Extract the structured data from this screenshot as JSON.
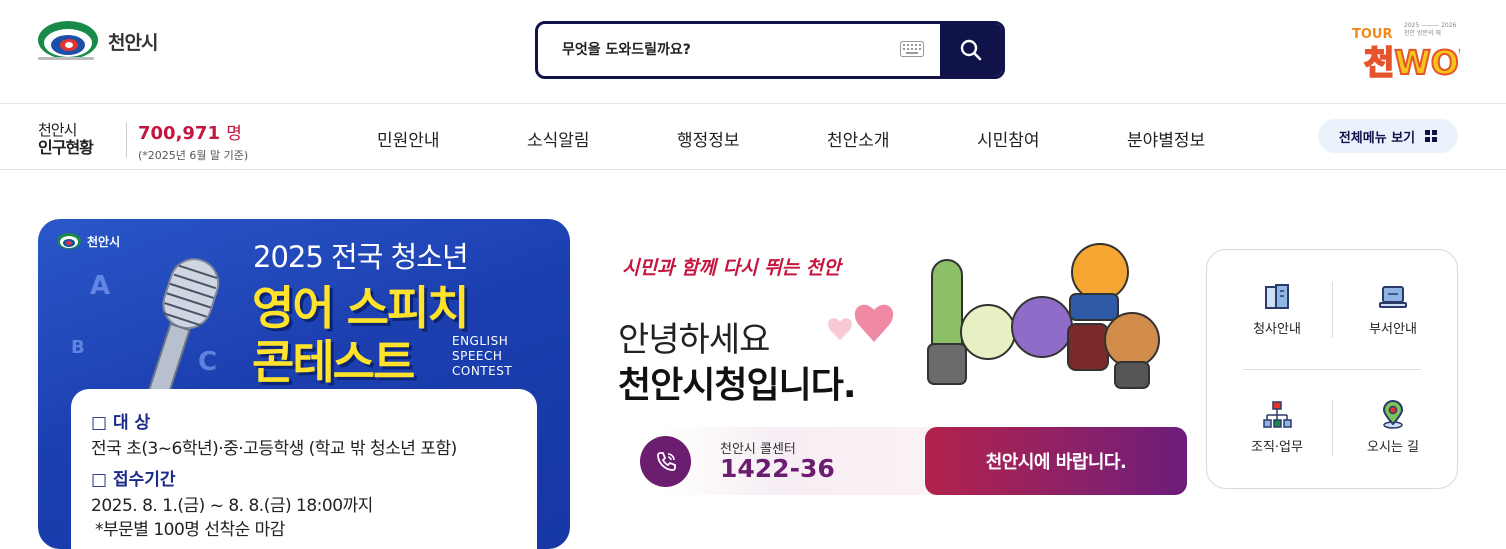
{
  "header": {
    "logo_text": "천안시",
    "search_placeholder": "무엇을 도와드릴까요?",
    "tour_logo": "TOUR 천안 WOW!",
    "tour_sub": "2025—2026 천안 방문의 해"
  },
  "nav": {
    "population_label_1": "천안시",
    "population_label_2": "인구현황",
    "population_value": "700,971",
    "population_unit": "명",
    "population_note": "(*2025년 6월 말 기준)",
    "menu": [
      "민원안내",
      "소식알림",
      "행정정보",
      "천안소개",
      "시민참여",
      "분야별정보"
    ],
    "all_menu": "전체메뉴 보기"
  },
  "banner": {
    "org": "천안시",
    "year_title": "2025 전국 청소년",
    "title_1": "영어 스피치",
    "title_2": "콘테스트",
    "eng_1": "ENGLISH",
    "eng_2": "SPEECH",
    "eng_3": "CONTEST",
    "target_heading": "□ 대  상",
    "target_text": "전국 초(3~6학년)·중·고등학생 (학교 밖 청소년 포함)",
    "period_heading": "□ 접수기간",
    "period_text": "2025. 8. 1.(금) ~ 8. 8.(금) 18:00까지",
    "period_note": "*부문별 100명 선착순 마감"
  },
  "welcome": {
    "slogan": "시민과 함께 다시 뛰는 천안",
    "hello": "안녕하세요",
    "cityhall": "천안시청입니다.",
    "call_label": "천안시 콜센터",
    "call_number": "1422-36",
    "wish_button": "천안시에 바랍니다."
  },
  "quick": {
    "items": [
      "청사안내",
      "부서안내",
      "조직·업무",
      "오시는 길"
    ]
  },
  "colors": {
    "navy": "#10124a",
    "crimson": "#c4163f",
    "purple": "#6b1d6f",
    "banner_blue": "#1c3fb0",
    "banner_yellow": "#ffe22b"
  }
}
